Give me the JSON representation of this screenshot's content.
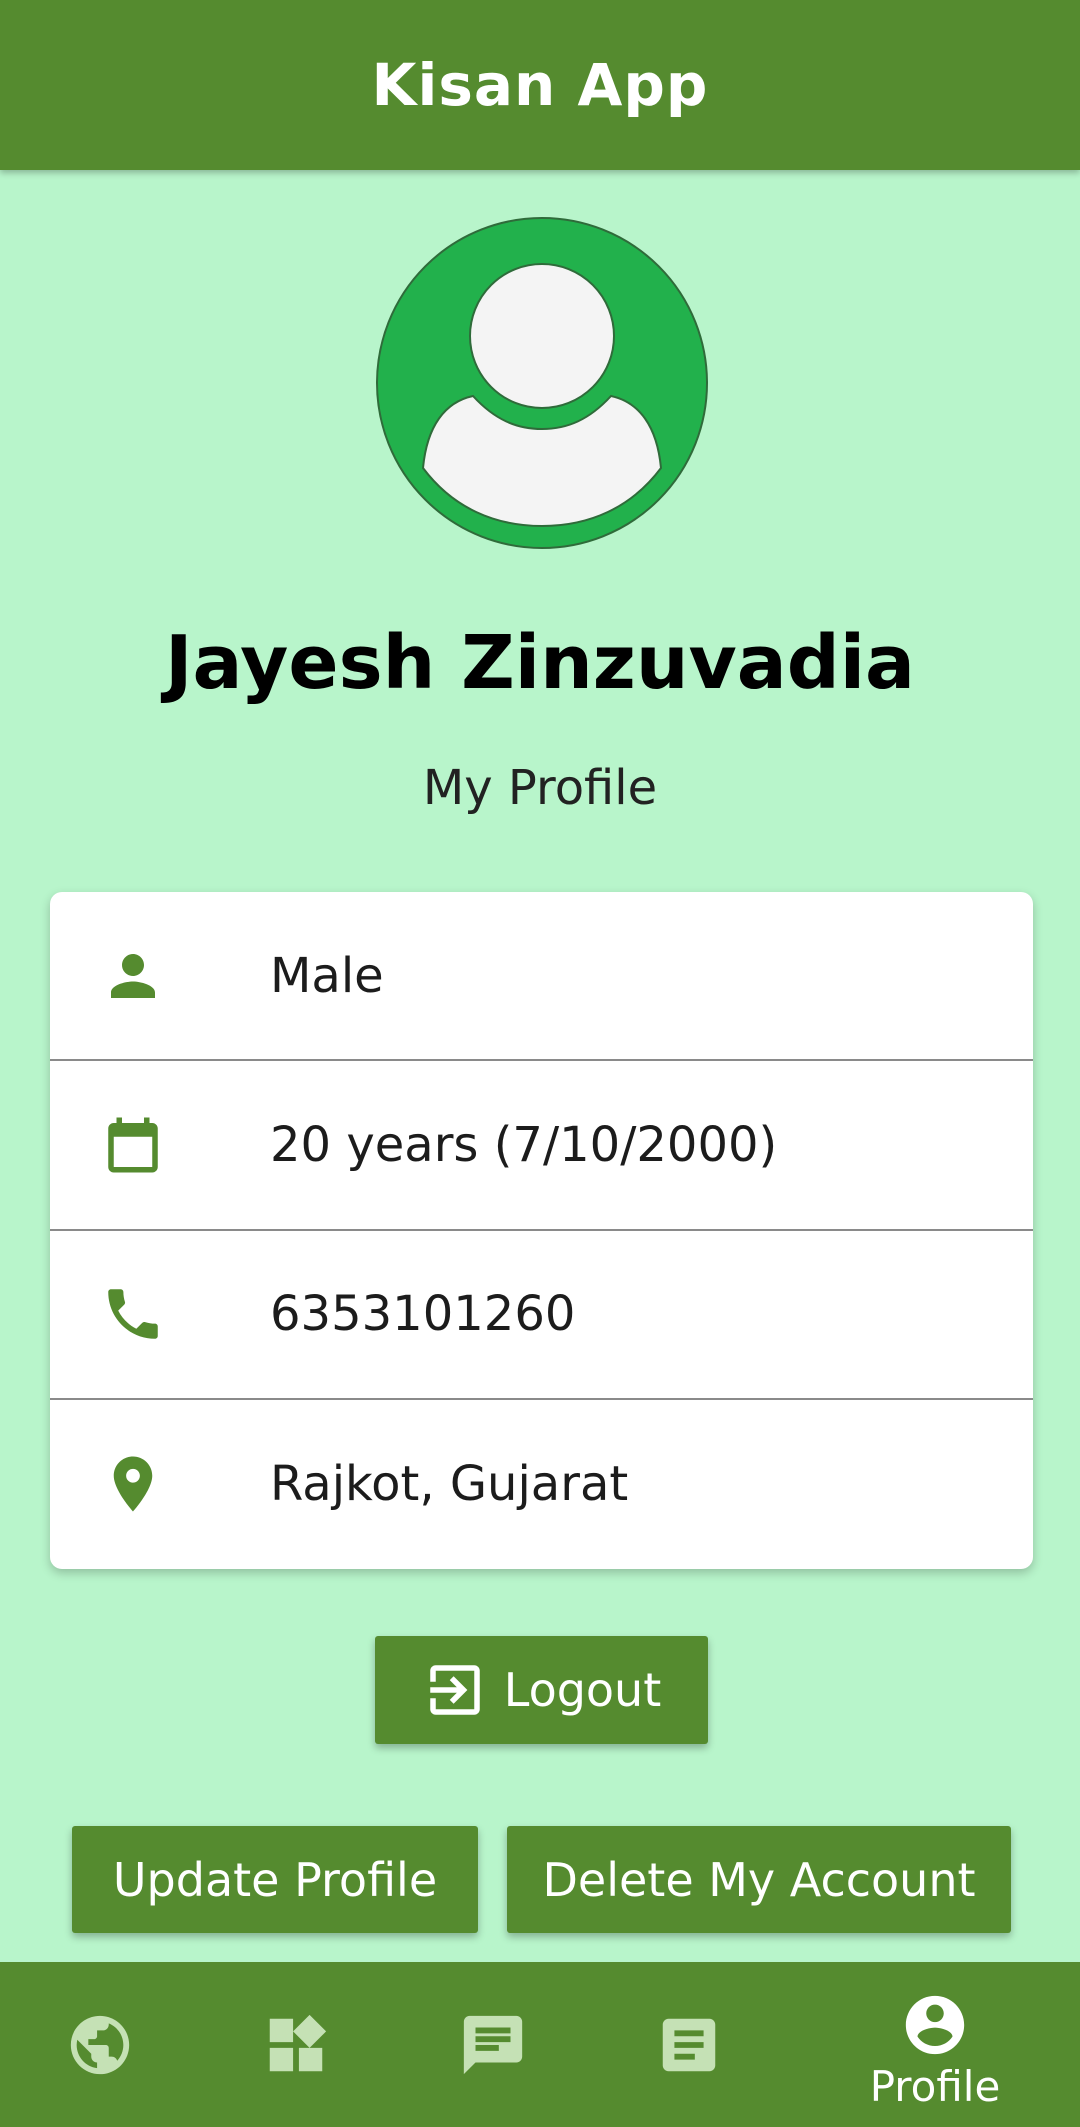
{
  "appbar": {
    "title": "Kisan App"
  },
  "profile": {
    "name": "Jayesh Zinzuvadia",
    "subtitle": "My Profile"
  },
  "details": [
    {
      "icon": "person-icon",
      "text": "Male"
    },
    {
      "icon": "calendar-icon",
      "text": "20 years (7/10/2000)"
    },
    {
      "icon": "phone-icon",
      "text": "6353101260"
    },
    {
      "icon": "location-pin-icon",
      "text": "Rajkot, Gujarat"
    }
  ],
  "buttons": {
    "logout": "Logout",
    "update": "Update Profile",
    "delete": "Delete My Account"
  },
  "bottom_nav": {
    "items": [
      {
        "icon": "globe-icon",
        "label": ""
      },
      {
        "icon": "widgets-icon",
        "label": ""
      },
      {
        "icon": "chat-icon",
        "label": ""
      },
      {
        "icon": "article-icon",
        "label": ""
      },
      {
        "icon": "account-circle-icon",
        "label": "Profile",
        "active": true
      }
    ]
  },
  "colors": {
    "primary": "#558b2f",
    "background": "#b8f5cb",
    "avatar_green": "#22b14c",
    "card": "#ffffff"
  }
}
